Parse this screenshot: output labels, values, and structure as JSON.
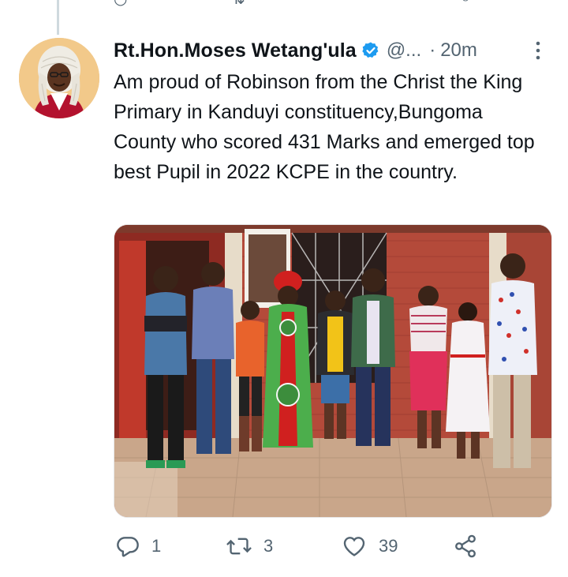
{
  "tweet": {
    "author_name": "Rt.Hon.Moses Wetang'ula",
    "handle": "@...",
    "separator": "·",
    "timestamp": "20m",
    "text": "Am proud of Robinson from the Christ the King Primary in Kanduyi constituency,Bungoma County who scored 431 Marks and emerged top best Pupil in 2022 KCPE in the country.",
    "verified": true,
    "media": {
      "kind": "photo"
    }
  },
  "actions": {
    "replies": "1",
    "retweets": "3",
    "likes": "39"
  },
  "colors": {
    "verified_blue": "#1d9bf0",
    "muted": "#536471",
    "text": "#0f1419"
  },
  "icons": [
    "reply-icon",
    "retweet-icon",
    "like-icon",
    "share-icon",
    "more-options-icon",
    "verified-badge-icon"
  ]
}
